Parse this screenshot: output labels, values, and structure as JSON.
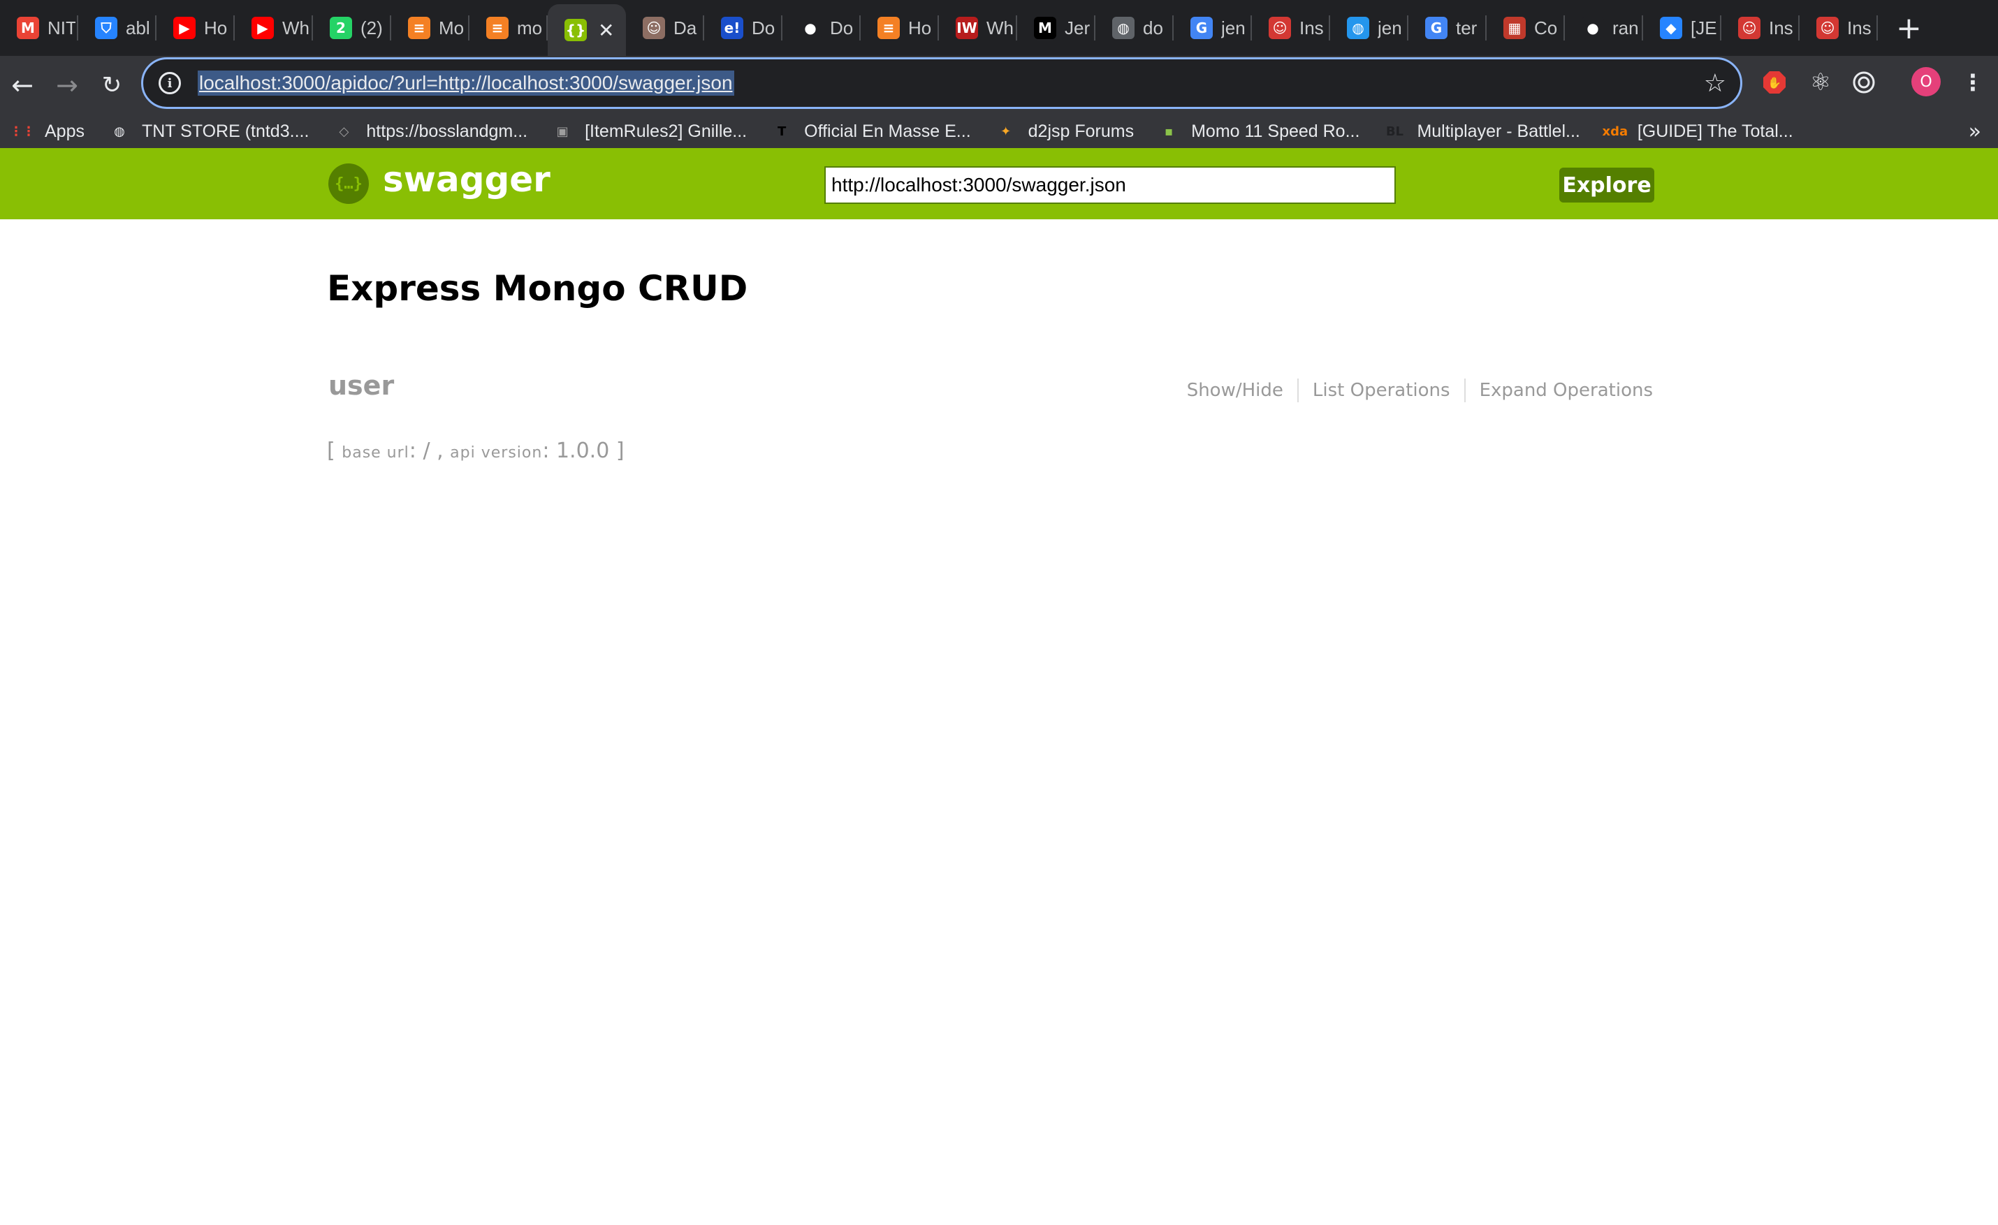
{
  "browser": {
    "tabs": [
      {
        "title": "NIT",
        "icon": "gmail-icon",
        "color": "#ea4335",
        "glyph": "M"
      },
      {
        "title": "abl",
        "icon": "bitbucket-icon",
        "color": "#2684ff",
        "glyph": "⛉"
      },
      {
        "title": "Ho",
        "icon": "youtube-icon",
        "color": "#ff0000",
        "glyph": "▶"
      },
      {
        "title": "Wh",
        "icon": "youtube-icon",
        "color": "#ff0000",
        "glyph": "▶"
      },
      {
        "title": "(2)",
        "icon": "whatsapp-icon",
        "color": "#25d366",
        "glyph": "2"
      },
      {
        "title": "Mo",
        "icon": "stackoverflow-icon",
        "color": "#f48024",
        "glyph": "≡"
      },
      {
        "title": "mo",
        "icon": "stackoverflow-icon",
        "color": "#f48024",
        "glyph": "≡"
      },
      {
        "title": "",
        "icon": "swagger-icon",
        "color": "#89bf04",
        "glyph": "{}",
        "active": true
      },
      {
        "title": "Da",
        "icon": "avatar-icon",
        "color": "#8d6e63",
        "glyph": "☺"
      },
      {
        "title": "Do",
        "icon": "ebay-icon",
        "color": "#1a4fcb",
        "glyph": "e!"
      },
      {
        "title": "Do",
        "icon": "github-icon",
        "color": "#202124",
        "glyph": "●"
      },
      {
        "title": "Ho",
        "icon": "stackoverflow-icon",
        "color": "#f48024",
        "glyph": "≡"
      },
      {
        "title": "Wh",
        "icon": "iw-icon",
        "color": "#b71c1c",
        "glyph": "IW"
      },
      {
        "title": "Jer",
        "icon": "medium-icon",
        "color": "#000000",
        "glyph": "M"
      },
      {
        "title": "do",
        "icon": "globe-icon",
        "color": "#5f6368",
        "glyph": "◍"
      },
      {
        "title": "jen",
        "icon": "google-icon",
        "color": "#4285f4",
        "glyph": "G"
      },
      {
        "title": "Ins",
        "icon": "jenkins-icon",
        "color": "#d33833",
        "glyph": "☺"
      },
      {
        "title": "jen",
        "icon": "docker-icon",
        "color": "#2496ed",
        "glyph": "◍"
      },
      {
        "title": "ter",
        "icon": "google-icon",
        "color": "#4285f4",
        "glyph": "G"
      },
      {
        "title": "Co",
        "icon": "squares-icon",
        "color": "#c0392b",
        "glyph": "▦"
      },
      {
        "title": "ran",
        "icon": "github-icon",
        "color": "#202124",
        "glyph": "●"
      },
      {
        "title": "[JE",
        "icon": "jira-icon",
        "color": "#2684ff",
        "glyph": "◆"
      },
      {
        "title": "Ins",
        "icon": "jenkins-icon",
        "color": "#d33833",
        "glyph": "☺"
      },
      {
        "title": "Ins",
        "icon": "jenkins-icon",
        "color": "#d33833",
        "glyph": "☺"
      }
    ],
    "close_glyph": "✕",
    "new_tab_glyph": "+",
    "url": "localhost:3000/apidoc/?url=http://localhost:3000/swagger.json",
    "profile_initial": "O",
    "bookmarks": [
      {
        "label": "Apps",
        "icon": "apps-grid-icon",
        "color": "#ea4335",
        "glyph": "⋮⋮"
      },
      {
        "label": "TNT STORE (tntd3....",
        "icon": "globe-icon",
        "color": "#e8eaed",
        "glyph": "◍"
      },
      {
        "label": "https://bosslandgm...",
        "icon": "page-icon",
        "color": "#9e9e9e",
        "glyph": "◇"
      },
      {
        "label": "[ItemRules2] Gnille...",
        "icon": "thumbnail-icon",
        "color": "#9e9e9e",
        "glyph": "▣"
      },
      {
        "label": "Official En Masse E...",
        "icon": "tera-icon",
        "color": "#000000",
        "glyph": "T"
      },
      {
        "label": "d2jsp Forums",
        "icon": "d2jsp-icon",
        "color": "#f9a825",
        "glyph": "✦"
      },
      {
        "label": "Momo 11 Speed Ro...",
        "icon": "momo-icon",
        "color": "#8bc34a",
        "glyph": "▪"
      },
      {
        "label": "Multiplayer - Battlel...",
        "icon": "battlelog-icon",
        "color": "#202124",
        "glyph": "BL"
      },
      {
        "label": "[GUIDE] The Total...",
        "icon": "xda-icon",
        "color": "#f57c00",
        "glyph": "xda"
      }
    ],
    "more_glyph": "»"
  },
  "swagger": {
    "logo_text": "swagger",
    "logo_glyph": "{…}",
    "spec_url": "http://localhost:3000/swagger.json",
    "explore_label": "Explore",
    "api_title": "Express Mongo CRUD",
    "resource": {
      "name": "user",
      "options": [
        "Show/Hide",
        "List Operations",
        "Expand Operations"
      ]
    },
    "info": {
      "base_url_label": "base url",
      "base_url": "/",
      "api_version_label": "api version",
      "api_version": "1.0.0"
    }
  }
}
